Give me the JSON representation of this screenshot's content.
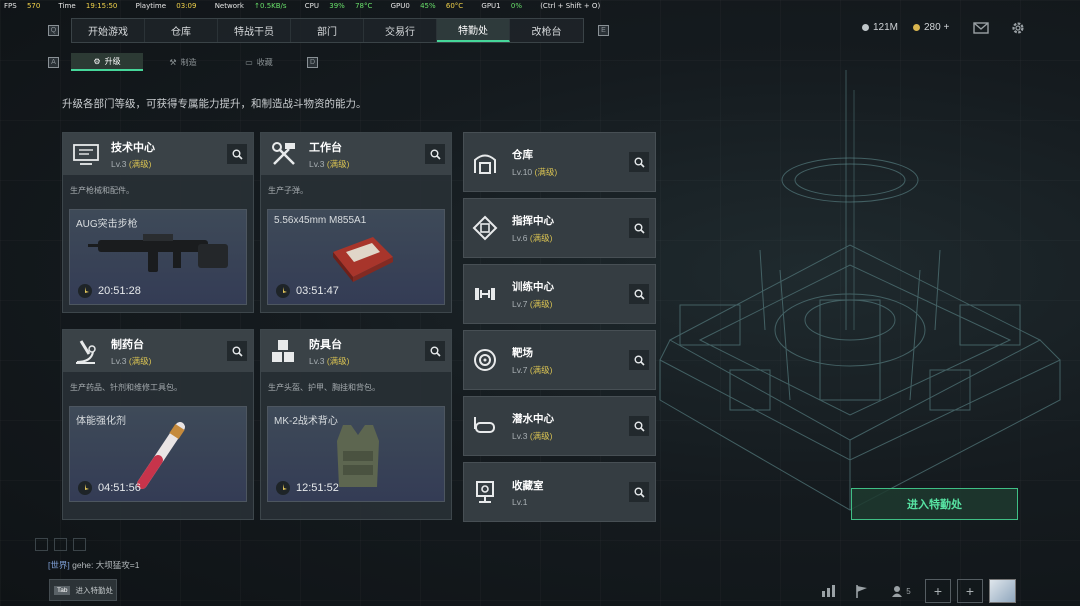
{
  "perf": {
    "fps_label": "FPS",
    "fps": "570",
    "time_label": "Time",
    "time": "19:15:50",
    "playtime_label": "Playtime",
    "playtime": "03:09",
    "network_label": "Network",
    "network": "↑0.5KB/s",
    "cpu_label": "CPU",
    "cpu_pct": "39%",
    "cpu_temp": "78°C",
    "gpu0_label": "GPU0",
    "gpu0_pct": "45%",
    "gpu0_temp": "60°C",
    "gpu1_label": "GPU1",
    "gpu1_pct": "0%",
    "shortcut": "(Ctrl + Shift + O)"
  },
  "nav": {
    "left_key": "Q",
    "right_key": "E",
    "tabs": [
      "开始游戏",
      "仓库",
      "特战干员",
      "部门",
      "交易行",
      "特勤处",
      "改枪台"
    ],
    "active_index": 5
  },
  "currency": {
    "silver": "121M",
    "gold": "280 +"
  },
  "subnav": {
    "left_key": "A",
    "right_key": "D",
    "tabs": [
      "升级",
      "制造",
      "收藏"
    ],
    "active_index": 0
  },
  "description": "升级各部门等级，可获得专属能力提升，和制造战斗物资的能力。",
  "big_cards": [
    {
      "title": "技术中心",
      "level": "Lv.3",
      "max": "(满级)",
      "subtitle": "生产枪械和配件。",
      "product": "AUG突击步枪",
      "timer": "20:51:28",
      "icon": "monitor-icon"
    },
    {
      "title": "工作台",
      "level": "Lv.3",
      "max": "(满级)",
      "subtitle": "生产子弹。",
      "product": "5.56x45mm M855A1",
      "timer": "03:51:47",
      "icon": "tools-icon"
    },
    {
      "title": "制药台",
      "level": "Lv.3",
      "max": "(满级)",
      "subtitle": "生产药品、针剂和维修工具包。",
      "product": "体能强化剂",
      "timer": "04:51:56",
      "icon": "microscope-icon"
    },
    {
      "title": "防具台",
      "level": "Lv.3",
      "max": "(满级)",
      "subtitle": "生产头盔、护甲、胸挂和背包。",
      "product": "MK-2战术背心",
      "timer": "12:51:52",
      "icon": "blocks-icon"
    }
  ],
  "small_cards": [
    {
      "title": "仓库",
      "level": "Lv.10",
      "max": "(满级)",
      "icon": "warehouse-icon"
    },
    {
      "title": "指挥中心",
      "level": "Lv.6",
      "max": "(满级)",
      "icon": "chip-icon"
    },
    {
      "title": "训练中心",
      "level": "Lv.7",
      "max": "(满级)",
      "icon": "dumbbell-icon"
    },
    {
      "title": "靶场",
      "level": "Lv.7",
      "max": "(满级)",
      "icon": "target-icon"
    },
    {
      "title": "潜水中心",
      "level": "Lv.3",
      "max": "(满级)",
      "icon": "goggles-icon"
    },
    {
      "title": "收藏室",
      "level": "Lv.1",
      "max": "",
      "icon": "trophy-icon"
    }
  ],
  "enter_button": "进入特勤处",
  "chat": {
    "channel": "[世界]",
    "user": "gehe",
    "message": "大坝猛攻=1"
  },
  "tab_hint": {
    "key": "Tab",
    "label": "进入特勤处"
  },
  "bottom": {
    "friends_count": "5"
  },
  "colors": {
    "accent": "#46d79a",
    "max_level": "#d7c152",
    "card_bg": "#353d42"
  }
}
